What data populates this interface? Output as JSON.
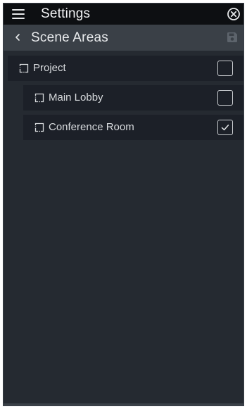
{
  "header": {
    "menu_icon": "hamburger-menu-icon",
    "title": "Settings",
    "close_icon": "close-circle-icon"
  },
  "subheader": {
    "back_icon": "chevron-left-icon",
    "title": "Scene Areas",
    "save_icon": "save-disk-icon"
  },
  "areas": [
    {
      "label": "Project",
      "icon": "area-icon",
      "checked": false,
      "level": 0
    },
    {
      "label": "Main Lobby",
      "icon": "area-icon",
      "checked": false,
      "level": 1
    },
    {
      "label": "Conference Room",
      "icon": "area-icon",
      "checked": true,
      "level": 1
    }
  ],
  "colors": {
    "topbar": "#0d0f12",
    "subheader": "#3a4047",
    "background": "#252a31",
    "row": "#1c2028",
    "text": "#d8dbde"
  }
}
